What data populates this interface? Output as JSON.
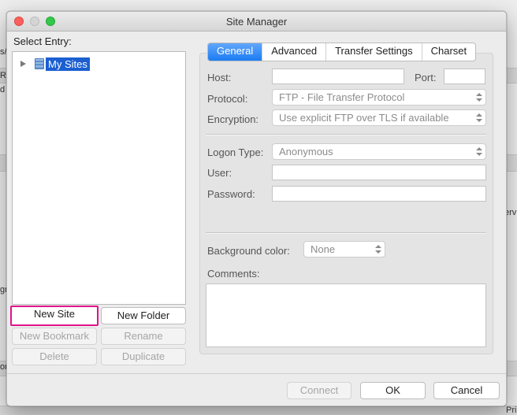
{
  "background_app": {
    "fragments": [
      "s/l",
      "Ro",
      "d",
      "gr",
      "erv",
      "ori",
      "Pri"
    ]
  },
  "dialog": {
    "title": "Site Manager"
  },
  "left": {
    "select_entry_label": "Select Entry:",
    "tree": {
      "root_label": "My Sites"
    },
    "buttons": {
      "new_site": "New Site",
      "new_folder": "New Folder",
      "new_bookmark": "New Bookmark",
      "rename": "Rename",
      "delete": "Delete",
      "duplicate": "Duplicate"
    }
  },
  "tabs": [
    {
      "label": "General",
      "active": true
    },
    {
      "label": "Advanced",
      "active": false
    },
    {
      "label": "Transfer Settings",
      "active": false
    },
    {
      "label": "Charset",
      "active": false
    }
  ],
  "general": {
    "host_label": "Host:",
    "host_value": "",
    "port_label": "Port:",
    "port_value": "",
    "protocol_label": "Protocol:",
    "protocol_value": "FTP - File Transfer Protocol",
    "encryption_label": "Encryption:",
    "encryption_value": "Use explicit FTP over TLS if available",
    "logon_type_label": "Logon Type:",
    "logon_type_value": "Anonymous",
    "user_label": "User:",
    "user_value": "",
    "password_label": "Password:",
    "password_value": "",
    "background_color_label": "Background color:",
    "background_color_value": "None",
    "comments_label": "Comments:",
    "comments_value": ""
  },
  "footer": {
    "connect": "Connect",
    "ok": "OK",
    "cancel": "Cancel"
  },
  "colors": {
    "tab_active": "#1b7cf3",
    "selection": "#1b5fd1",
    "highlight_outline": "#e0148c"
  },
  "icons": {
    "site_tree_root": "server-icon",
    "disclosure": "disclosure-triangle-icon",
    "select": "up-down-arrows-icon"
  }
}
